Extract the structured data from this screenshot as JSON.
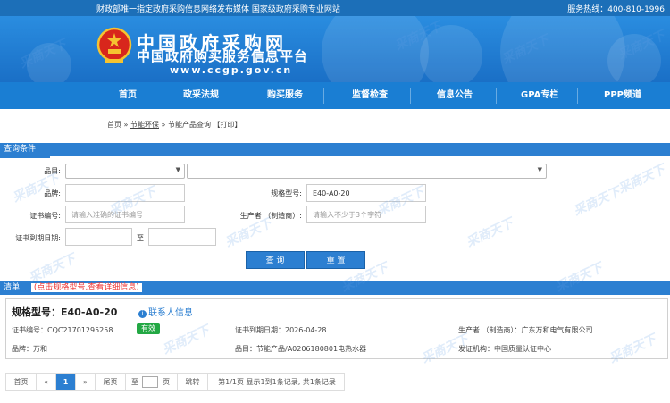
{
  "topstrip": {
    "slogan": "财政部唯一指定政府采购信息网络发布媒体 国家级政府采购专业网站",
    "hotline": "服务热线：400-810-1996"
  },
  "banner": {
    "title": "中国政府采购网",
    "subtitle": "中国政府购买服务信息平台",
    "url": "www.ccgp.gov.cn"
  },
  "nav": [
    "首页",
    "政采法规",
    "购买服务",
    "监督检查",
    "信息公告",
    "GPA专栏",
    "PPP频道"
  ],
  "breadcrumb": {
    "home": "首页",
    "sep": "»",
    "eco": "节能环保",
    "query": "节能产品查询",
    "print": "【打印】"
  },
  "query": {
    "header": "查询条件",
    "category_label": "品目:",
    "brand_label": "品牌:",
    "model_label": "规格型号:",
    "model_value": "E40-A0-20",
    "cert_label": "证书编号:",
    "cert_placeholder": "请输入准确的证书编号",
    "maker_label": "生产者 （制造商）:",
    "maker_placeholder": "请输入不少于3个字符",
    "expire_label": "证书到期日期:",
    "to_label": "至",
    "search_btn": "查 询",
    "reset_btn": "重 置"
  },
  "list": {
    "header": "清单",
    "hint": "(点击规格型号,查看详细信息)"
  },
  "result": {
    "spec": "规格型号：E40-A0-20",
    "contact": "联系人信息",
    "cert_no": "证书编号：CQC21701295258",
    "status": "有效",
    "expire": "证书到期日期：2026-04-28",
    "maker": "生产者 （制造商）：广东万和电气有限公司",
    "brand": "品牌：万和",
    "category": "品目：节能产品/A0206180801电热水器",
    "issuer": "发证机构：中国质量认证中心"
  },
  "pager": {
    "first": "首页",
    "prev": "«",
    "current": "1",
    "next": "»",
    "last": "尾页",
    "goto_prefix": "至",
    "goto_suffix": "页",
    "jump": "跳转",
    "info": "第1/1页 显示1到1条记录, 共1条记录"
  },
  "watermark": "采商天下",
  "colors": {
    "primary": "#2c7fd1",
    "nav": "#1a7ed3",
    "badge_green": "#23a844",
    "hint_red": "#e33333"
  }
}
